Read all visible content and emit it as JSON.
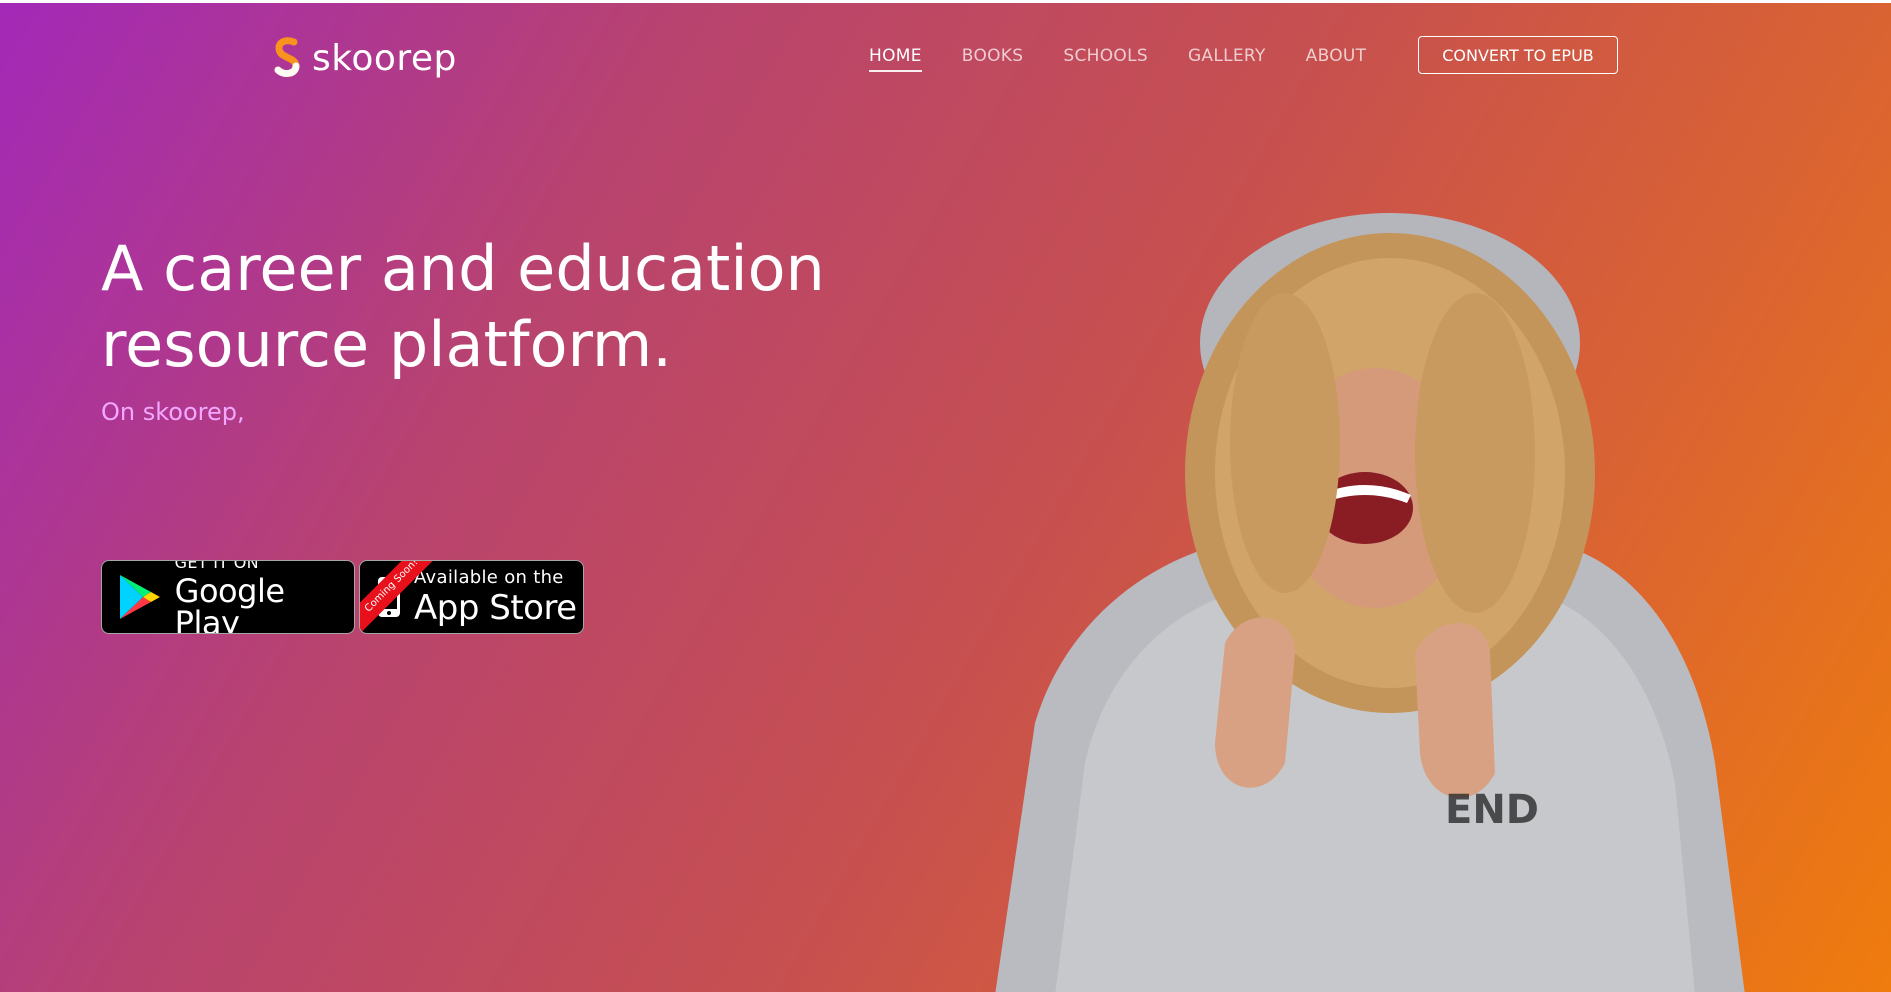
{
  "brand": {
    "name": "skoorep",
    "logo_icon": "skoorep-s-logo"
  },
  "nav": {
    "items": [
      {
        "label": "HOME",
        "active": true
      },
      {
        "label": "BOOKS",
        "active": false
      },
      {
        "label": "SCHOOLS",
        "active": false
      },
      {
        "label": "GALLERY",
        "active": false
      },
      {
        "label": "ABOUT",
        "active": false
      }
    ],
    "cta_label": "CONVERT TO EPUB"
  },
  "hero": {
    "headline_line1": "A career and education",
    "headline_line2": "resource platform.",
    "subline": "On skoorep,",
    "image": "smiling-person-in-hoodie"
  },
  "badges": {
    "google": {
      "small": "GET IT ON",
      "large": "Google Play",
      "icon": "google-play-icon"
    },
    "apple": {
      "small": "Available on the",
      "large": "App Store",
      "ribbon": "Coming Soon!",
      "icon": "iphone-icon"
    }
  },
  "colors": {
    "gradient_start": "#a329b8",
    "gradient_end": "#ef7c0d",
    "subline": "#f2a8ff",
    "ribbon": "#e8101a"
  }
}
